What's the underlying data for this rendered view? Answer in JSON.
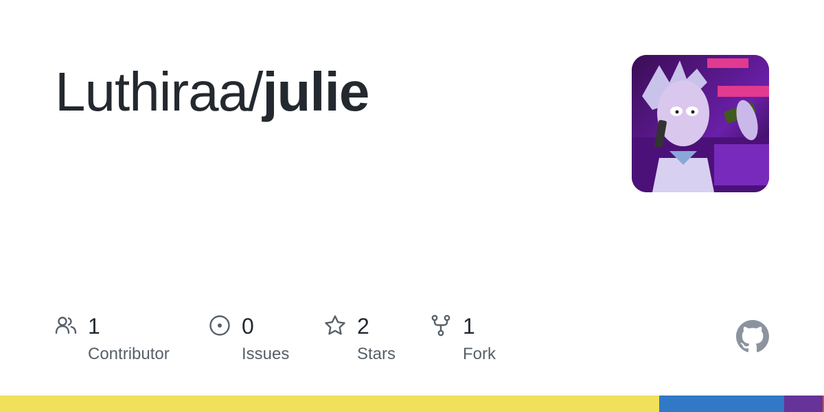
{
  "repo": {
    "owner": "Luthiraa/",
    "name": "julie"
  },
  "avatar": {
    "alt": "avatar-image",
    "colors": [
      "#2a0a3f",
      "#6a1fa8",
      "#e23a8f",
      "#c9b8e8"
    ]
  },
  "stats": {
    "contributors": {
      "count": "1",
      "label": "Contributor",
      "icon": "people-icon"
    },
    "issues": {
      "count": "0",
      "label": "Issues",
      "icon": "issue-opened-icon"
    },
    "stars": {
      "count": "2",
      "label": "Stars",
      "icon": "star-icon"
    },
    "forks": {
      "count": "1",
      "label": "Fork",
      "icon": "repo-forked-icon"
    }
  },
  "logo": {
    "icon": "github-mark-icon",
    "color": "#8b949e"
  },
  "languages": [
    {
      "color": "#f1e05a",
      "fraction": 0.8
    },
    {
      "color": "#3178c6",
      "fraction": 0.152
    },
    {
      "color": "#663399",
      "fraction": 0.046
    },
    {
      "color": "#e34c26",
      "fraction": 0.002
    }
  ],
  "colors": {
    "text": "#24292f",
    "muted": "#57606a",
    "icon": "#57606a"
  }
}
